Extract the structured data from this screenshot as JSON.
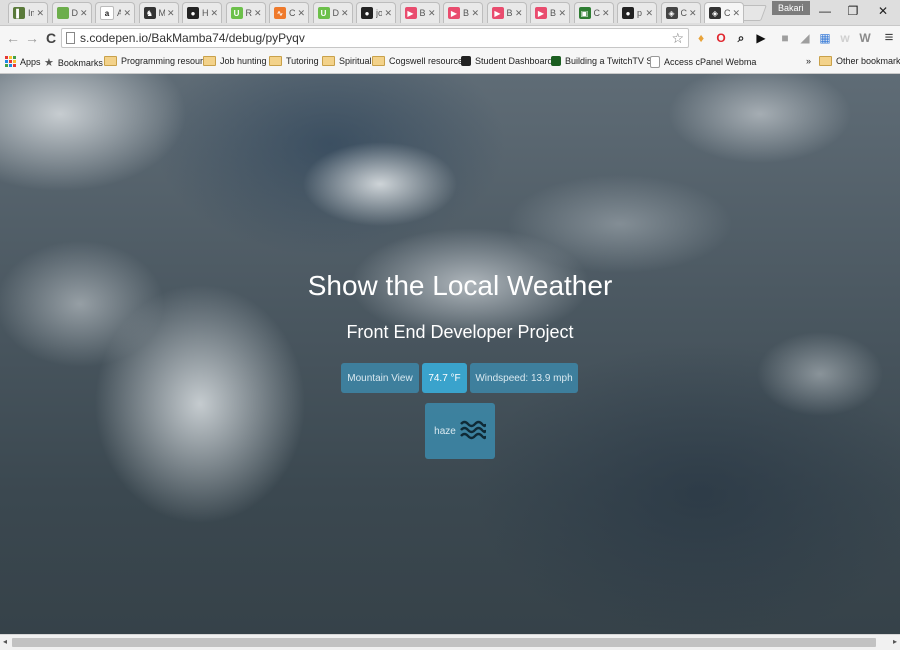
{
  "browser": {
    "tabs": [
      {
        "label": "Im",
        "icon_color": "#5a7a3a",
        "glyph": "▌"
      },
      {
        "label": "D",
        "icon_color": "#6cae4b",
        "glyph": ""
      },
      {
        "label": "A",
        "icon_color": "#ffffff",
        "glyph": "a"
      },
      {
        "label": "M",
        "icon_color": "#333333",
        "glyph": "♞"
      },
      {
        "label": "Hi",
        "icon_color": "#222222",
        "glyph": "●"
      },
      {
        "label": "R",
        "icon_color": "#6cc04a",
        "glyph": "U"
      },
      {
        "label": "Cl",
        "icon_color": "#ef7a2c",
        "glyph": "∿"
      },
      {
        "label": "D",
        "icon_color": "#6cc04a",
        "glyph": "U"
      },
      {
        "label": "jo",
        "icon_color": "#222222",
        "glyph": "●"
      },
      {
        "label": "B",
        "icon_color": "#e94c6e",
        "glyph": "▶"
      },
      {
        "label": "B",
        "icon_color": "#e94c6e",
        "glyph": "▶"
      },
      {
        "label": "Bi",
        "icon_color": "#e94c6e",
        "glyph": "▶"
      },
      {
        "label": "Bi",
        "icon_color": "#e94c6e",
        "glyph": "▶"
      },
      {
        "label": "C",
        "icon_color": "#2e7d32",
        "glyph": "▣"
      },
      {
        "label": "p",
        "icon_color": "#222222",
        "glyph": "●"
      },
      {
        "label": "Cl",
        "icon_color": "#444444",
        "glyph": "◈"
      },
      {
        "label": "C",
        "icon_color": "#333333",
        "glyph": "◈"
      }
    ],
    "close_glyph": "✕",
    "profile_name": "Bakari",
    "window_controls": {
      "minimize": "—",
      "maximize": "❐",
      "close": "✕"
    }
  },
  "toolbar": {
    "back": "←",
    "forward": "→",
    "reload": "C",
    "url": "s.codepen.io/BakMamba74/debug/pyPyqv",
    "star": "☆",
    "menu": "≡",
    "extensions": [
      {
        "name": "bell-extension-icon",
        "glyph": "♦",
        "color": "#e8a33a"
      },
      {
        "name": "opera-extension-icon",
        "glyph": "O",
        "color": "#e0262e"
      },
      {
        "name": "magnifier-extension-icon",
        "glyph": "⌕",
        "color": "#222222"
      },
      {
        "name": "play-extension-icon",
        "glyph": "▶",
        "color": "#111111"
      },
      {
        "name": "gray-square-extension-icon",
        "glyph": "■",
        "color": "#9e9e9e"
      },
      {
        "name": "flag-extension-icon",
        "glyph": "◢",
        "color": "#9e9e9e"
      },
      {
        "name": "colorful-extension-icon",
        "glyph": "▦",
        "color": "#3b7dd8"
      },
      {
        "name": "w-extension-icon",
        "glyph": "w",
        "color": "#d0d0d0"
      },
      {
        "name": "w-dark-extension-icon",
        "glyph": "W",
        "color": "#8a8a8a"
      }
    ]
  },
  "bookmarks": {
    "apps": "Apps",
    "items": [
      {
        "label": "Bookmarks",
        "kind": "star"
      },
      {
        "label": "Programming resourc",
        "kind": "folder"
      },
      {
        "label": "Job hunting",
        "kind": "folder"
      },
      {
        "label": "Tutoring",
        "kind": "folder"
      },
      {
        "label": "Spiritual",
        "kind": "folder"
      },
      {
        "label": "Cogswell resources",
        "kind": "folder"
      },
      {
        "label": "Student Dashboard",
        "kind": "site"
      },
      {
        "label": "Building a TwitchTV S",
        "kind": "site"
      },
      {
        "label": "Access cPanel Webma",
        "kind": "page"
      }
    ],
    "overflow": "»",
    "other": "Other bookmarks"
  },
  "page": {
    "title": "Show the Local Weather",
    "subtitle": "Front End Developer Project",
    "location": "Mountain View",
    "temperature": "74.7 °F",
    "windspeed": "Windspeed: 13.9 mph",
    "condition": "haze",
    "condition_icon": "haze-icon",
    "accent_color": "#3aa3cc"
  },
  "scrollbar": {
    "left": "◂",
    "right": "▸"
  }
}
